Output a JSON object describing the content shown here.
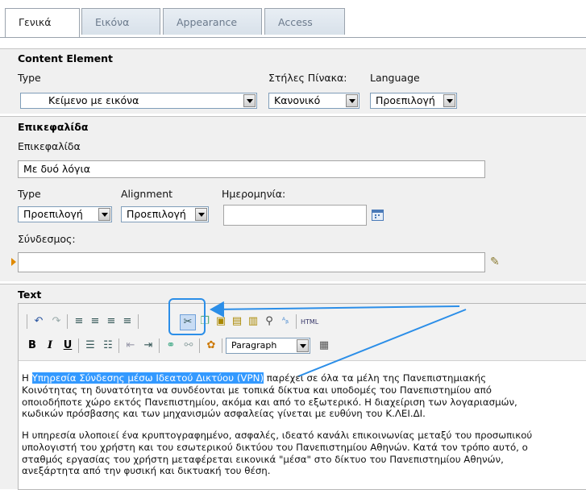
{
  "tabs": [
    "Γενικά",
    "Εικόνα",
    "Appearance",
    "Access"
  ],
  "content_element": {
    "title": "Content Element",
    "type_label": "Type",
    "type_value": "Κείμενο με εικόνα",
    "columns_label": "Στήλες Πίνακα:",
    "columns_value": "Κανονικό",
    "language_label": "Language",
    "language_value": "Προεπιλογή"
  },
  "header": {
    "title": "Επικεφαλίδα",
    "field_label": "Επικεφαλίδα",
    "field_value": "Με δυό λόγια",
    "type_label": "Type",
    "type_value": "Προεπιλογή",
    "alignment_label": "Alignment",
    "alignment_value": "Προεπιλογή",
    "date_label": "Ημερομηνία:",
    "date_value": "",
    "link_label": "Σύνδεσμος:",
    "link_value": ""
  },
  "text_section": {
    "title": "Text",
    "html_label": "HTML",
    "format_value": "Paragraph",
    "paragraph1_prefix": "Η ",
    "paragraph1_highlight": "Υπηρεσία Σύνδεσης μέσω Ιδεατού Δικτύου (VPN)",
    "paragraph1_line1_rest": " παρέχει σε όλα τα μέλη της Πανεπιστημιακής",
    "paragraph1_line2": "Κοινότητας τη δυνατότητα να συνδέονται με τοπικά δίκτυα και υποδομές του Πανεπιστημίου από",
    "paragraph1_line3": "οποιοδήποτε χώρο εκτός Πανεπιστημίου, ακόμα και από το εξωτερικό. Η διαχείριση των λογαριασμών,",
    "paragraph1_line4": "κωδικών πρόσβασης και των μηχανισμών ασφαλείας γίνεται με ευθύνη του Κ.ΛΕΙ.ΔΙ.",
    "paragraph2_line1": "Η υπηρεσία υλοποιεί ένα κρυπτογραφημένο, ασφαλές, ιδεατό κανάλι επικοινωνίας μεταξύ του προσωπικού",
    "paragraph2_line2": "υπολογιστή του χρήστη και του εσωτερικού δικτύου του Πανεπιστημίου Αθηνών. Κατά τον τρόπο αυτό, ο",
    "paragraph2_line3": "σταθμός εργασίας του χρήστη μεταφέρεται εικονικά \"μέσα\" στο δίκτυο του Πανεπιστημίου Αθηνών,",
    "paragraph2_line4": "ανεξάρτητα από την φυσική και δικτυακή του θέση."
  },
  "colors": {
    "accent": "#3399ff",
    "section_bg": "#f0f0f0",
    "tab_text": "#6b7a8c"
  }
}
